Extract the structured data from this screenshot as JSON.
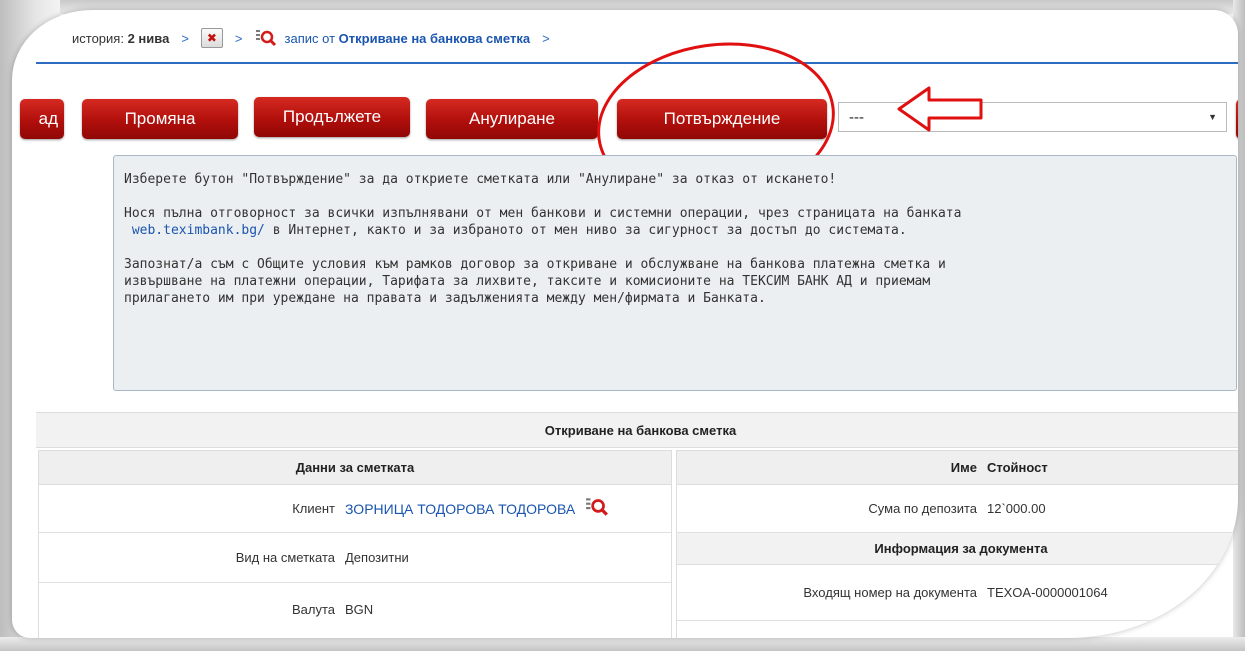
{
  "breadcrumb": {
    "history_prefix": "история:",
    "history_count": "2 нива",
    "record_prefix": "запис от",
    "record_title": "Откриване на банкова сметка"
  },
  "toolbar": {
    "back_label": "ад",
    "change_label": "Промяна",
    "continue_label": "Продължете",
    "cancel_label": "Анулиране",
    "confirm_label": "Потвърждение",
    "select_value": "---"
  },
  "notice": {
    "line1": "Изберете бутон \"Потвърждение\" за да откриете сметката или \"Анулиране\" за отказ от искането!",
    "line2a": "Нося пълна отговорност за всички изпълнявани от мен банкови и системни операции, чрез страницата на банката",
    "line2_link": "web.teximbank.bg/",
    "line2b": " в Интернет, както и за избраното от мен ниво за сигурност за достъп до системата.",
    "line3": "Запознат/а съм с Общите условия към рамков договор за откриване и обслужване на банкова платежна сметка и\nизвършване на платежни операции, Тарифата за лихвите, таксите и комисионите на ТЕКСИМ БАНК АД и приемам\nприлагането им при уреждане на правата и задълженията между мен/фирмата и Банката."
  },
  "section_title": "Откриване на банкова сметка",
  "account": {
    "header": "Данни за сметката",
    "rows": [
      {
        "label": "Клиент",
        "value": "ЗОРНИЦА ТОДОРОВА ТОДОРОВА"
      },
      {
        "label": "Вид на сметката",
        "value": "Депозитни"
      },
      {
        "label": "Валута",
        "value": "BGN"
      }
    ]
  },
  "details": {
    "col_name": "Име",
    "col_value": "Стойност",
    "deposit_label": "Сума по депозита",
    "deposit_value": "12`000.00",
    "doc_header": "Информация за документа",
    "doc_label": "Входящ номер на документа",
    "doc_value": "TEXOA-0000001064"
  },
  "colors": {
    "accent_red": "#b10f0c",
    "link_blue": "#1a55b0",
    "annotation_red": "#e01010"
  }
}
